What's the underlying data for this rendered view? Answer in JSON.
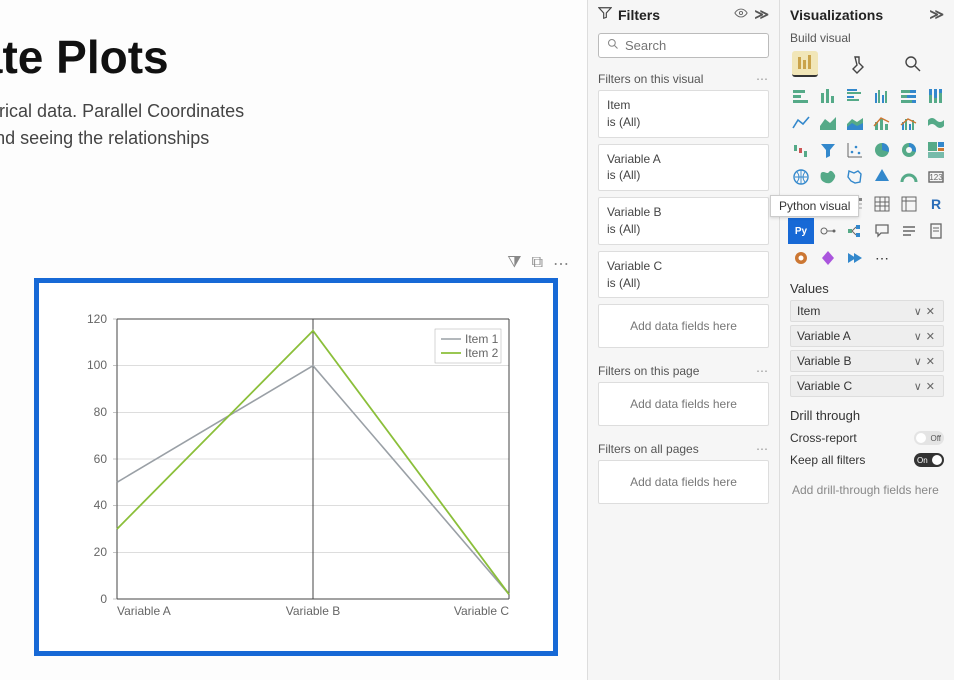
{
  "canvas": {
    "title": "rdinate Plots",
    "desc1": "variate, numerical data. Parallel Coordinates",
    "desc2": "es together and seeing the relationships"
  },
  "chart_data": {
    "type": "line",
    "categories": [
      "Variable A",
      "Variable B",
      "Variable C"
    ],
    "series": [
      {
        "name": "Item 1",
        "values": [
          50,
          100,
          2
        ],
        "color": "#9aa0a6"
      },
      {
        "name": "Item 2",
        "values": [
          30,
          115,
          2
        ],
        "color": "#8bbf3a"
      }
    ],
    "ylim": [
      0,
      120
    ],
    "yticks": [
      0,
      20,
      40,
      60,
      80,
      100,
      120
    ],
    "xlabel": "",
    "ylabel": "",
    "title": ""
  },
  "filters": {
    "pane_title": "Filters",
    "search_placeholder": "Search",
    "section_visual": "Filters on this visual",
    "section_page": "Filters on this page",
    "section_all": "Filters on all pages",
    "add_fields": "Add data fields here",
    "is_all": "is (All)",
    "cards": [
      {
        "name": "Item"
      },
      {
        "name": "Variable A"
      },
      {
        "name": "Variable B"
      },
      {
        "name": "Variable C"
      }
    ]
  },
  "viz": {
    "pane_title": "Visualizations",
    "build_label": "Build visual",
    "tooltip": "Python visual",
    "values_label": "Values",
    "fields": [
      "Item",
      "Variable A",
      "Variable B",
      "Variable C"
    ],
    "drill_label": "Drill through",
    "cross_report": "Cross-report",
    "cross_report_state": "Off",
    "keep_filters": "Keep all filters",
    "keep_filters_state": "On",
    "drill_drop": "Add drill-through fields here"
  }
}
